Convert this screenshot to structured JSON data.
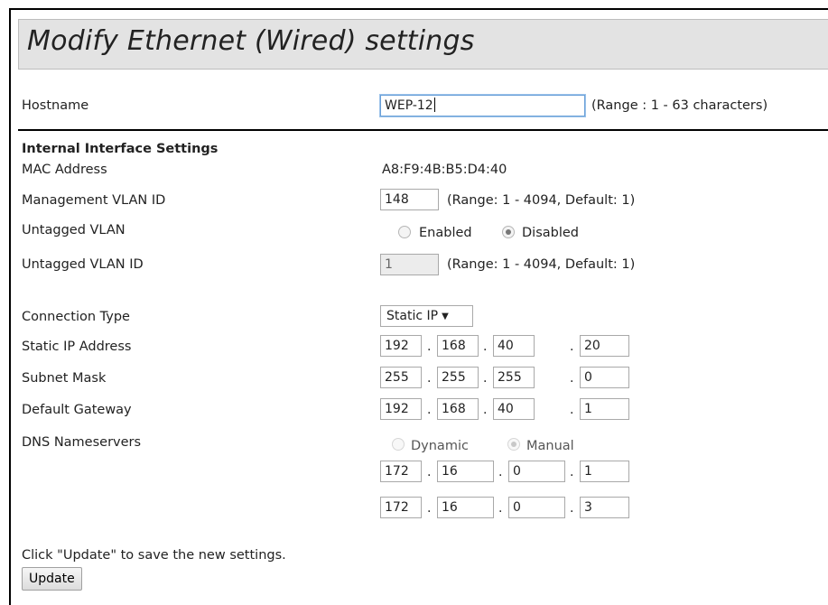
{
  "page": {
    "title": "Modify Ethernet (Wired) settings"
  },
  "hostname": {
    "label": "Hostname",
    "value": "WEP-12",
    "range": "(Range : 1 - 63 characters)"
  },
  "internal": {
    "section_title": "Internal Interface Settings",
    "mac_label": "MAC Address",
    "mac_value": "A8:F9:4B:B5:D4:40",
    "mgmt_vlan_label": "Management VLAN ID",
    "mgmt_vlan_value": "148",
    "mgmt_vlan_range": "(Range: 1 - 4094, Default: 1)",
    "untagged_label": "Untagged VLAN",
    "untagged_enabled": "Enabled",
    "untagged_disabled": "Disabled",
    "untagged_selected": "Disabled",
    "untagged_id_label": "Untagged VLAN ID",
    "untagged_id_value": "1",
    "untagged_id_range": "(Range: 1 - 4094, Default: 1)"
  },
  "connection": {
    "type_label": "Connection Type",
    "type_value": "Static IP",
    "static_ip_label": "Static IP Address",
    "static_ip": [
      "192",
      "168",
      "40",
      "20"
    ],
    "subnet_label": "Subnet Mask",
    "subnet": [
      "255",
      "255",
      "255",
      "0"
    ],
    "gateway_label": "Default Gateway",
    "gateway": [
      "192",
      "168",
      "40",
      "1"
    ],
    "dns_label": "DNS Nameservers",
    "dns_dynamic": "Dynamic",
    "dns_manual": "Manual",
    "dns_selected": "Manual",
    "dns1": [
      "172",
      "16",
      "0",
      "1"
    ],
    "dns2": [
      "172",
      "16",
      "0",
      "3"
    ]
  },
  "footer": {
    "hint": "Click \"Update\" to save the new settings.",
    "update_label": "Update"
  },
  "separator": "."
}
